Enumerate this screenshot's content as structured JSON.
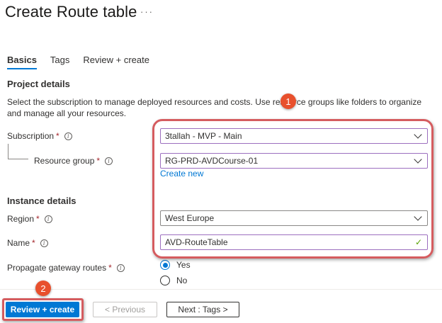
{
  "page": {
    "title": "Create Route table",
    "more": "···"
  },
  "tabs": [
    {
      "label": "Basics",
      "active": true
    },
    {
      "label": "Tags",
      "active": false
    },
    {
      "label": "Review + create",
      "active": false
    }
  ],
  "project_details": {
    "heading": "Project details",
    "description": "Select the subscription to manage deployed resources and costs. Use resource groups like folders to organize and manage all your resources.",
    "subscription": {
      "label": "Subscription",
      "required": "*",
      "value": "3tallah - MVP - Main"
    },
    "resource_group": {
      "label": "Resource group",
      "required": "*",
      "value": "RG-PRD-AVDCourse-01",
      "create_new": "Create new"
    }
  },
  "instance_details": {
    "heading": "Instance details",
    "region": {
      "label": "Region",
      "required": "*",
      "value": "West Europe"
    },
    "name": {
      "label": "Name",
      "required": "*",
      "value": "AVD-RouteTable"
    },
    "propagate": {
      "label": "Propagate gateway routes",
      "required": "*",
      "options": [
        "Yes",
        "No"
      ],
      "selected": "Yes"
    }
  },
  "annotations": {
    "badge1": "1",
    "badge2": "2"
  },
  "footer": {
    "review_create": "Review + create",
    "previous": "< Previous",
    "next": "Next : Tags >"
  },
  "colors": {
    "accent": "#0078d4",
    "highlight": "#d55c5f",
    "badge": "#e8502d",
    "valid_check": "#57a300"
  },
  "icons": {
    "info": "info-icon",
    "chevron": "chevron-down-icon",
    "check": "check-icon"
  }
}
